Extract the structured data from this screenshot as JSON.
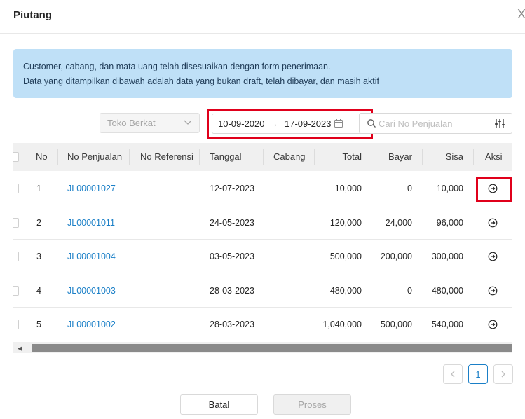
{
  "modal": {
    "title": "Piutang",
    "close_glyph": "X"
  },
  "alert": {
    "line1": "Customer, cabang, dan mata uang telah disesuaikan dengan form penerimaan.",
    "line2": "Data yang ditampilkan dibawah adalah data yang bukan draft, telah dibayar, dan masih aktif"
  },
  "filters": {
    "store_select": "Toko Berkat",
    "date_from": "10-09-2020",
    "date_arrow": "→",
    "date_to": "17-09-2023",
    "search_placeholder": "Cari No Penjualan"
  },
  "table": {
    "columns": [
      "No",
      "No Penjualan",
      "No Referensi",
      "Tanggal",
      "Cabang",
      "Total",
      "Bayar",
      "Sisa",
      "Aksi"
    ],
    "rows": [
      {
        "no": "1",
        "no_penjualan": "JL00001027",
        "no_referensi": "",
        "tanggal": "12-07-2023",
        "cabang": "",
        "total": "10,000",
        "bayar": "0",
        "sisa": "10,000"
      },
      {
        "no": "2",
        "no_penjualan": "JL00001011",
        "no_referensi": "",
        "tanggal": "24-05-2023",
        "cabang": "",
        "total": "120,000",
        "bayar": "24,000",
        "sisa": "96,000"
      },
      {
        "no": "3",
        "no_penjualan": "JL00001004",
        "no_referensi": "",
        "tanggal": "03-05-2023",
        "cabang": "",
        "total": "500,000",
        "bayar": "200,000",
        "sisa": "300,000"
      },
      {
        "no": "4",
        "no_penjualan": "JL00001003",
        "no_referensi": "",
        "tanggal": "28-03-2023",
        "cabang": "",
        "total": "480,000",
        "bayar": "0",
        "sisa": "480,000"
      },
      {
        "no": "5",
        "no_penjualan": "JL00001002",
        "no_referensi": "",
        "tanggal": "28-03-2023",
        "cabang": "",
        "total": "1,040,000",
        "bayar": "500,000",
        "sisa": "540,000"
      }
    ]
  },
  "pagination": {
    "current_page": "1"
  },
  "footer": {
    "cancel_label": "Batal",
    "process_label": "Proses"
  },
  "colors": {
    "link": "#1a7fc7",
    "alert_bg": "#bfe0f7",
    "highlight": "#e0001b"
  },
  "icons": [
    "close-icon",
    "chevron-down-icon",
    "calendar-icon",
    "search-icon",
    "filter-icon",
    "arrow-circle-right-icon",
    "chevron-left-icon",
    "chevron-right-icon"
  ]
}
